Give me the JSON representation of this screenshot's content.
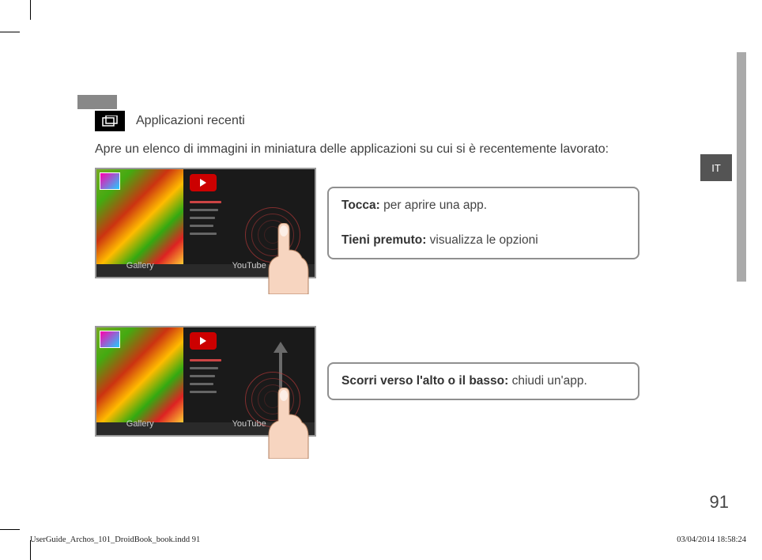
{
  "lang_tab": "IT",
  "title": "Applicazioni recenti",
  "intro": "Apre un elenco di immagini in miniatura delle applicazioni su cui si è recentemente lavorato:",
  "thumb": {
    "left_label": "Gallery",
    "right_label": "YouTube"
  },
  "callout1": {
    "tap_label": "Tocca:",
    "tap_text": " per aprire una app.",
    "hold_label": "Tieni premuto:",
    "hold_text": " visualizza le opzioni"
  },
  "callout2": {
    "swipe_label": "Scorri verso l'alto o il basso:",
    "swipe_text": " chiudi un'app."
  },
  "page_number": "91",
  "footer": {
    "left": "UserGuide_Archos_101_DroidBook_book.indd   91",
    "right": "03/04/2014   18:58:24"
  }
}
